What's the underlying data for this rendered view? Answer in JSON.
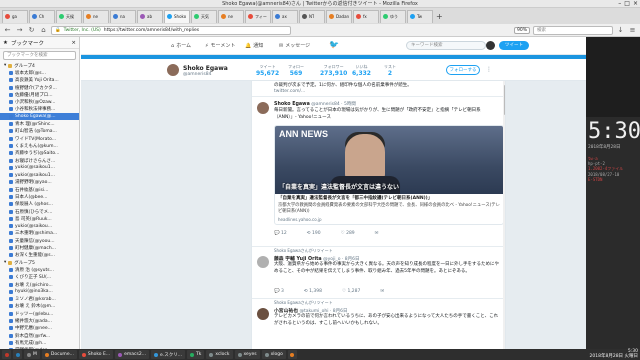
{
  "window": {
    "title": "Shoko Egawa(@amneris84)さん | Twitterからの返信付きツイート - Mozilla Firefox"
  },
  "tabs": [
    {
      "label": "ga",
      "color": "#e74c3c",
      "active": false
    },
    {
      "label": "Ch",
      "color": "#3b7bd4",
      "active": false
    },
    {
      "label": "天候",
      "color": "#2ecc71",
      "active": false
    },
    {
      "label": "ne",
      "color": "#e67e22",
      "active": false
    },
    {
      "label": "na",
      "color": "#3b7bd4",
      "active": false
    },
    {
      "label": "ab",
      "color": "#9b59b6",
      "active": false
    },
    {
      "label": "Shoko E",
      "color": "#1da1f2",
      "active": true
    },
    {
      "label": "天気",
      "color": "#2ecc71",
      "active": false
    },
    {
      "label": "ne",
      "color": "#e67e22",
      "active": false
    },
    {
      "label": "フィード",
      "color": "#e74c3c",
      "active": false
    },
    {
      "label": "ax",
      "color": "#3b7bd4",
      "active": false
    },
    {
      "label": "NT",
      "color": "#555555",
      "active": false
    },
    {
      "label": "Dadan",
      "color": "#e67e22",
      "active": false
    },
    {
      "label": "fx",
      "color": "#e74c3c",
      "active": false
    },
    {
      "label": "ゆう",
      "color": "#2ecc71",
      "active": false
    },
    {
      "label": "Tw",
      "color": "#1da1f2",
      "active": false
    }
  ],
  "nav": {
    "site_label": "Twitter, Inc. (US)",
    "url": "https://twitter.com/amneris84/with_replies",
    "zoom": "90%",
    "search_placeholder": "検索"
  },
  "sidebar": {
    "title": "ブックマーク",
    "search_placeholder": "ブックマークを検索",
    "items": [
      {
        "label": "グループ4",
        "type": "folder",
        "selected": false
      },
      {
        "label": "坂本太郎(@s...",
        "type": "link",
        "selected": false
      },
      {
        "label": "高良鉄美 Yoji Orita...",
        "type": "link",
        "selected": false
      },
      {
        "label": "植野健介(アカクタ...",
        "type": "link",
        "selected": false
      },
      {
        "label": "佐藤優(月組プロ...",
        "type": "link",
        "selected": false
      },
      {
        "label": "小沢和秋(@Ozaw...",
        "type": "link",
        "selected": false
      },
      {
        "label": "小谷和秋法律事務...",
        "type": "link",
        "selected": false
      },
      {
        "label": "Shoko Egawa(@...",
        "type": "link",
        "selected": true
      },
      {
        "label": "青木 理(@rShinc...",
        "type": "link",
        "selected": false
      },
      {
        "label": "町山智浩 (@Toma...",
        "type": "link",
        "selected": false
      },
      {
        "label": "ワイドTV(Morato...",
        "type": "link",
        "selected": false
      },
      {
        "label": "くまえもん(@kum...",
        "type": "link",
        "selected": false
      },
      {
        "label": "斉藤ゆうぢ(@Saito...",
        "type": "link",
        "selected": false
      },
      {
        "label": "お寝ぼけさらんさ...",
        "type": "link",
        "selected": false
      },
      {
        "label": "yukio(@saikou1...",
        "type": "link",
        "selected": false
      },
      {
        "label": "yukio(@saikou1...",
        "type": "link",
        "selected": false
      },
      {
        "label": "湯野野明(@yao...",
        "type": "link",
        "selected": false
      },
      {
        "label": "石井紘基(@isi...",
        "type": "link",
        "selected": false
      },
      {
        "label": "日本人(@bee...",
        "type": "link",
        "selected": false
      },
      {
        "label": "保坂展人 (@hos...",
        "type": "link",
        "selected": false
      },
      {
        "label": "石原慎(ひらでメ...",
        "type": "link",
        "selected": false
      },
      {
        "label": "島 司英(@Ruuk...",
        "type": "link",
        "selected": false
      },
      {
        "label": "yukio(@saikou...",
        "type": "link",
        "selected": false
      },
      {
        "label": "三木重明(@shima...",
        "type": "link",
        "selected": false
      },
      {
        "label": "天童陳信(@yoou...",
        "type": "link",
        "selected": false
      },
      {
        "label": "町村健康(@mach...",
        "type": "link",
        "selected": false
      },
      {
        "label": "お深く生重能(@s...",
        "type": "link",
        "selected": false
      },
      {
        "label": "グループ5",
        "type": "folder",
        "selected": false
      },
      {
        "label": "清原 治 (@syuts...",
        "type": "link",
        "selected": false
      },
      {
        "label": "くびり正子 SU(...",
        "type": "link",
        "selected": false
      },
      {
        "label": "お壊 え(@ichiro...",
        "type": "link",
        "selected": false
      },
      {
        "label": "hyuki(@ino3ka...",
        "type": "link",
        "selected": false
      },
      {
        "label": "ミソノ君(@ksrab...",
        "type": "link",
        "selected": false
      },
      {
        "label": "お壊 え 鈴木(@m...",
        "type": "link",
        "selected": false
      },
      {
        "label": "ドッツー(@lebu...",
        "type": "link",
        "selected": false
      },
      {
        "label": "緒井悠大(@ada...",
        "type": "link",
        "selected": false
      },
      {
        "label": "中野元暦(@nee...",
        "type": "link",
        "selected": false
      },
      {
        "label": "鈴木自然(@rfw...",
        "type": "link",
        "selected": false
      },
      {
        "label": "有馬元成(@h...",
        "type": "link",
        "selected": false
      },
      {
        "label": "常野代都(@dea...",
        "type": "link",
        "selected": false
      },
      {
        "label": "Ryo Tamaki(@...",
        "type": "link",
        "selected": false
      }
    ]
  },
  "twitter": {
    "nav": [
      {
        "label": "ホーム",
        "icon": "home-icon"
      },
      {
        "label": "モーメント",
        "icon": "lightning-icon"
      },
      {
        "label": "通知",
        "icon": "bell-icon"
      },
      {
        "label": "メッセージ",
        "icon": "mail-icon"
      }
    ],
    "search_placeholder": "キーワード検索",
    "tweet_button": "ツイート",
    "profile": {
      "name": "Shoko Egawa",
      "handle": "@amneris84",
      "stats": [
        {
          "label": "ツイート",
          "value": "95,672"
        },
        {
          "label": "フォロー",
          "value": "569"
        },
        {
          "label": "フォロワー",
          "value": "273,910"
        },
        {
          "label": "いいね",
          "value": "6,332"
        },
        {
          "label": "リスト",
          "value": "2"
        }
      ],
      "follow_button": "フォローする"
    },
    "tweets": [
      {
        "head": "",
        "text": "の裁判が次まで予定。1に何か、組印件な個人の名前業事件が続生。",
        "link": "twitter.com/...",
        "actions": []
      },
      {
        "head_name": "Shoko Egawa",
        "head_meta": "@amneris84 · 5時間",
        "text": "毎日新聞。言ってることが日本の現場は気がかりが、生に問題が「政府不安定」と指摘「テレビ朝日系（ANN）」- Yahoo!ニュース",
        "card": {
          "logo": "ANN NEWS",
          "caption": "「自業を真実」違法監督長が文言は違うない",
          "title": "「自業を真実」違法監督長が文言を「都三中指紋議(テレビ朝日系(ANN))」",
          "desc": "京都大学の教員間の会員経費発表の要素の文部科学大臣の問題で、会長、同様の会員の比べ - Yahoo!ニュース(テレビ朝日系(ANN))",
          "domain": "headlines.yahoo.co.jp"
        },
        "actions": [
          "12",
          "190",
          "289"
        ]
      },
      {
        "rt_line": "Shoko Egawaさんがリツイート",
        "head_name": "藤森 宇輔 Yuji Orita",
        "head_meta": "@yoji_o · 8月6日",
        "text": "大阪、滋賀県から始める事件の事実から大きく異なる。天の声を知り成長の程度を一日に外し手をするためにやめること、その中が結果を伝えてしまう事件、取り組み年、過去5年半の問題を。あとにぞある。",
        "actions": [
          "3",
          "1,398",
          "1,287"
        ]
      },
      {
        "rt_line": "Shoko Egawaさんがリツイート",
        "head_name": "小宮山祐也",
        "head_meta": "@takumi_ohi · 8月6日",
        "text": "テレビカメラの前で何か言われているうちに、あの子が安心出来るようになって大人たちの手で書くこと、これがされるというのは、すこし前へいいかもしれない。",
        "actions": []
      }
    ]
  },
  "right_panel": {
    "time": "5:30",
    "date": "2018年8月28日",
    "lines": [
      "tw-a",
      "hp-pt-2",
      "1.2002-4ファイル",
      "2018/08/27-10",
      "E-STDN"
    ]
  },
  "taskbar": {
    "items": [
      {
        "label": "",
        "color": "#c0392b",
        "icon": "app-icon"
      },
      {
        "label": "",
        "color": "#2980b9",
        "icon": "app-icon"
      },
      {
        "label": "M",
        "color": "#888888",
        "icon": "mail-icon"
      },
      {
        "label": "Docume...",
        "color": "#e67e22"
      },
      {
        "label": "Shoko E...",
        "color": "#e74c3c"
      },
      {
        "label": "emacs2...",
        "color": "#9b59b6"
      },
      {
        "label": "e.スクリ...",
        "color": "#3498db"
      },
      {
        "label": "Tk",
        "color": "#27ae60"
      },
      {
        "label": "xclock",
        "color": "#7f8c8d"
      },
      {
        "label": "xeyes",
        "color": "#7f8c8d"
      },
      {
        "label": "xlogo",
        "color": "#7f8c8d"
      },
      {
        "label": "",
        "color": "#e67e22"
      }
    ],
    "clock_time": "5:30",
    "clock_date": "2018年8月28日 火曜日"
  }
}
